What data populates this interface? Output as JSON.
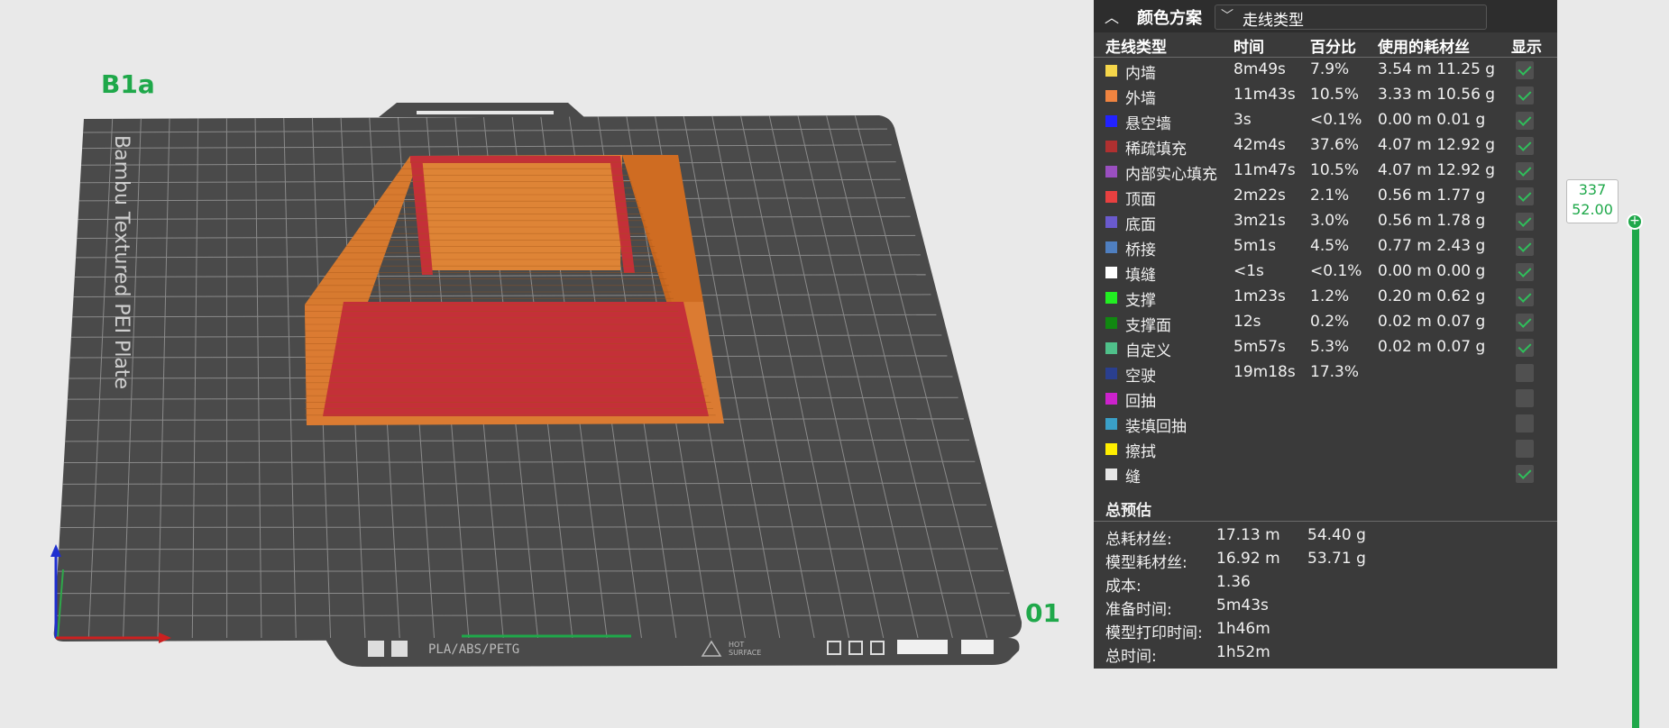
{
  "plate": {
    "name": "B1a",
    "number": "01",
    "vertical_label": "Bambu Textured PEI Plate",
    "material_label": "PLA/ABS/PETG",
    "surface_label_line1": "HOT",
    "surface_label_line2": "SURFACE"
  },
  "legend": {
    "title": "颜色方案",
    "scheme_selected": "走线类型",
    "columns": {
      "type": "走线类型",
      "time": "时间",
      "percent": "百分比",
      "filament": "使用的耗材丝",
      "show": "显示"
    },
    "rows": [
      {
        "name": "内墙",
        "color": "#f5d64a",
        "time": "8m49s",
        "percent": "7.9%",
        "filament": "3.54 m  11.25 g",
        "show": true
      },
      {
        "name": "外墙",
        "color": "#f08440",
        "time": "11m43s",
        "percent": "10.5%",
        "filament": "3.33 m  10.56 g",
        "show": true
      },
      {
        "name": "悬空墙",
        "color": "#2222ff",
        "time": "3s",
        "percent": "<0.1%",
        "filament": "0.00 m  0.01 g",
        "show": true
      },
      {
        "name": "稀疏填充",
        "color": "#b03030",
        "time": "42m4s",
        "percent": "37.6%",
        "filament": "4.07 m  12.92 g",
        "show": true
      },
      {
        "name": "内部实心填充",
        "color": "#9a4fc0",
        "time": "11m47s",
        "percent": "10.5%",
        "filament": "4.07 m  12.92 g",
        "show": true
      },
      {
        "name": "顶面",
        "color": "#e84040",
        "time": "2m22s",
        "percent": "2.1%",
        "filament": "0.56 m  1.77 g",
        "show": true
      },
      {
        "name": "底面",
        "color": "#6a5acd",
        "time": "3m21s",
        "percent": "3.0%",
        "filament": "0.56 m  1.78 g",
        "show": true
      },
      {
        "name": "桥接",
        "color": "#4f7fc0",
        "time": "5m1s",
        "percent": "4.5%",
        "filament": "0.77 m  2.43 g",
        "show": true
      },
      {
        "name": "填缝",
        "color": "#ffffff",
        "time": "<1s",
        "percent": "<0.1%",
        "filament": "0.00 m  0.00 g",
        "show": true
      },
      {
        "name": "支撑",
        "color": "#22ee22",
        "time": "1m23s",
        "percent": "1.2%",
        "filament": "0.20 m  0.62 g",
        "show": true
      },
      {
        "name": "支撑面",
        "color": "#118811",
        "time": "12s",
        "percent": "0.2%",
        "filament": "0.02 m  0.07 g",
        "show": true
      },
      {
        "name": "自定义",
        "color": "#4fc08a",
        "time": "5m57s",
        "percent": "5.3%",
        "filament": "0.02 m  0.07 g",
        "show": true
      },
      {
        "name": "空驶",
        "color": "#2a3f8f",
        "time": "19m18s",
        "percent": "17.3%",
        "filament": "",
        "show": false
      },
      {
        "name": "回抽",
        "color": "#cc22cc",
        "time": "",
        "percent": "",
        "filament": "",
        "show": false
      },
      {
        "name": "装填回抽",
        "color": "#3aa0c8",
        "time": "",
        "percent": "",
        "filament": "",
        "show": false
      },
      {
        "name": "擦拭",
        "color": "#ffee00",
        "time": "",
        "percent": "",
        "filament": "",
        "show": false
      },
      {
        "name": "缝",
        "color": "#e6e6e6",
        "time": "",
        "percent": "",
        "filament": "",
        "show": true
      }
    ],
    "estimate": {
      "title": "总预估",
      "total_filament": {
        "label": "总耗材丝:",
        "length": "17.13 m",
        "weight": "54.40 g"
      },
      "model_filament": {
        "label": "模型耗材丝:",
        "length": "16.92 m",
        "weight": "53.71 g"
      },
      "cost": {
        "label": "成本:",
        "value": "1.36"
      },
      "prepare_time": {
        "label": "准备时间:",
        "value": "5m43s"
      },
      "model_print_time": {
        "label": "模型打印时间:",
        "value": "1h46m"
      },
      "total_time": {
        "label": "总时间:",
        "value": "1h52m"
      }
    }
  },
  "layer_slider": {
    "layer": "337",
    "height": "52.00"
  },
  "colors": {
    "accent": "#1fa84a",
    "plate": "#4a4a4a",
    "grid": "#8a8a8a",
    "model_orange": "#d8782e",
    "model_red": "#c0303a",
    "panel": "#3a3a3a"
  }
}
